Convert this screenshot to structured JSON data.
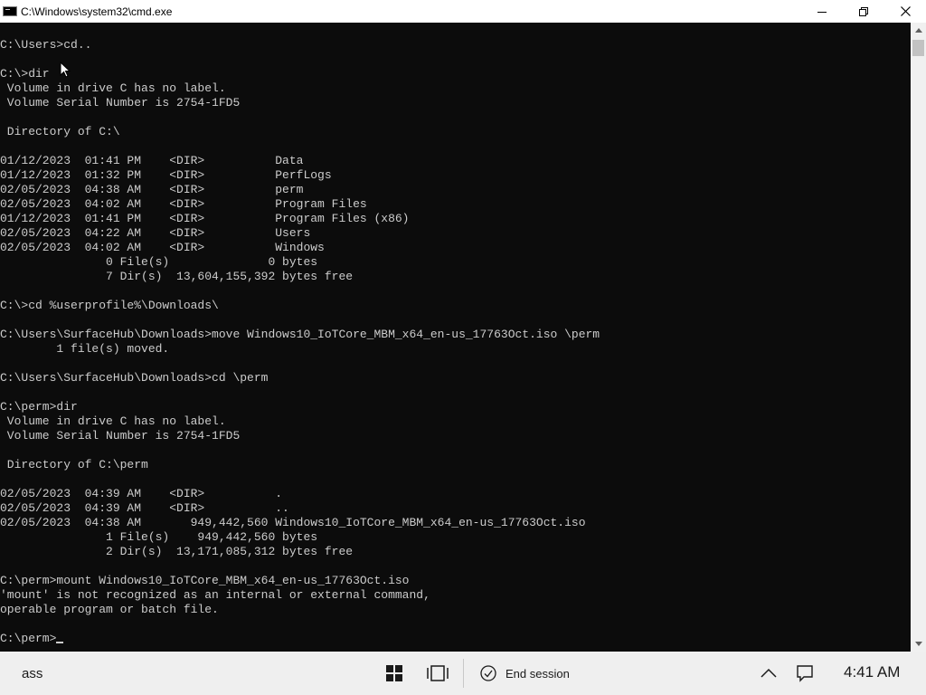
{
  "window": {
    "title": "C:\\Windows\\system32\\cmd.exe",
    "icon": "cmd-app-icon",
    "controls": [
      "minimize-icon",
      "restore-icon",
      "close-icon"
    ]
  },
  "console": {
    "lines": [
      "C:\\Users>cd..",
      "",
      "C:\\>dir",
      " Volume in drive C has no label.",
      " Volume Serial Number is 2754-1FD5",
      "",
      " Directory of C:\\",
      "",
      "01/12/2023  01:41 PM    <DIR>          Data",
      "01/12/2023  01:32 PM    <DIR>          PerfLogs",
      "02/05/2023  04:38 AM    <DIR>          perm",
      "02/05/2023  04:02 AM    <DIR>          Program Files",
      "01/12/2023  01:41 PM    <DIR>          Program Files (x86)",
      "02/05/2023  04:22 AM    <DIR>          Users",
      "02/05/2023  04:02 AM    <DIR>          Windows",
      "               0 File(s)              0 bytes",
      "               7 Dir(s)  13,604,155,392 bytes free",
      "",
      "C:\\>cd %userprofile%\\Downloads\\",
      "",
      "C:\\Users\\SurfaceHub\\Downloads>move Windows10_IoTCore_MBM_x64_en-us_17763Oct.iso \\perm",
      "        1 file(s) moved.",
      "",
      "C:\\Users\\SurfaceHub\\Downloads>cd \\perm",
      "",
      "C:\\perm>dir",
      " Volume in drive C has no label.",
      " Volume Serial Number is 2754-1FD5",
      "",
      " Directory of C:\\perm",
      "",
      "02/05/2023  04:39 AM    <DIR>          .",
      "02/05/2023  04:39 AM    <DIR>          ..",
      "02/05/2023  04:38 AM       949,442,560 Windows10_IoTCore_MBM_x64_en-us_17763Oct.iso",
      "               1 File(s)    949,442,560 bytes",
      "               2 Dir(s)  13,171,085,312 bytes free",
      "",
      "C:\\perm>mount Windows10_IoTCore_MBM_x64_en-us_17763Oct.iso",
      "'mount' is not recognized as an internal or external command,",
      "operable program or batch file.",
      ""
    ],
    "prompt": "C:\\perm>",
    "colors": {
      "background": "#0c0c0c",
      "text": "#cccccc"
    }
  },
  "taskbar": {
    "user_label": "ass",
    "end_session_label": "End session",
    "clock": "4:41 AM",
    "icons": [
      "windows-start-icon",
      "task-view-icon",
      "check-circle-icon",
      "chevron-up-icon",
      "notification-icon"
    ]
  }
}
